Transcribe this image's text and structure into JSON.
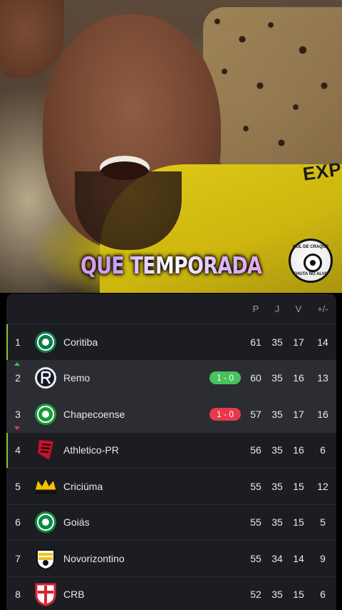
{
  "video": {
    "caption": "QUE TEMPORADA",
    "shirt_text": "EXP",
    "watermark": {
      "top_text": "GOL DE CRAQUE",
      "bottom_text": "CHUTA NO ALVO"
    }
  },
  "table": {
    "headers": {
      "points": "P",
      "played": "J",
      "wins": "V",
      "goal_diff": "+/-"
    },
    "rows": [
      {
        "pos": "1",
        "team": "Coritiba",
        "crest": "coritiba-crest-icon",
        "crest_color": "#0e7b4b",
        "score": "",
        "points": "61",
        "played": "35",
        "wins": "17",
        "gd": "14"
      },
      {
        "pos": "2",
        "team": "Remo",
        "crest": "remo-crest-icon",
        "crest_color": "#14182a",
        "score": "1 - 0",
        "result": "win",
        "trend": "up",
        "points": "60",
        "played": "35",
        "wins": "16",
        "gd": "13"
      },
      {
        "pos": "3",
        "team": "Chapecoense",
        "crest": "chapecoense-crest-icon",
        "crest_color": "#1a9a3a",
        "score": "1 - 0",
        "result": "loss",
        "trend": "down",
        "points": "57",
        "played": "35",
        "wins": "17",
        "gd": "16"
      },
      {
        "pos": "4",
        "team": "Athletico-PR",
        "crest": "athletico-crest-icon",
        "crest_color": "#c8102e",
        "score": "",
        "points": "56",
        "played": "35",
        "wins": "16",
        "gd": "6"
      },
      {
        "pos": "5",
        "team": "Criciúma",
        "crest": "criciuma-crest-icon",
        "crest_color": "#f2c200",
        "score": "",
        "points": "55",
        "played": "35",
        "wins": "15",
        "gd": "12"
      },
      {
        "pos": "6",
        "team": "Goiás",
        "crest": "goias-crest-icon",
        "crest_color": "#0d8a43",
        "score": "",
        "points": "55",
        "played": "35",
        "wins": "15",
        "gd": "5"
      },
      {
        "pos": "7",
        "team": "Novorizontino",
        "crest": "novorizontino-crest-icon",
        "crest_color": "#f0c419",
        "score": "",
        "points": "55",
        "played": "34",
        "wins": "14",
        "gd": "9"
      },
      {
        "pos": "8",
        "team": "CRB",
        "crest": "crb-crest-icon",
        "crest_color": "#d9252f",
        "score": "",
        "points": "52",
        "played": "35",
        "wins": "15",
        "gd": "6"
      }
    ]
  }
}
